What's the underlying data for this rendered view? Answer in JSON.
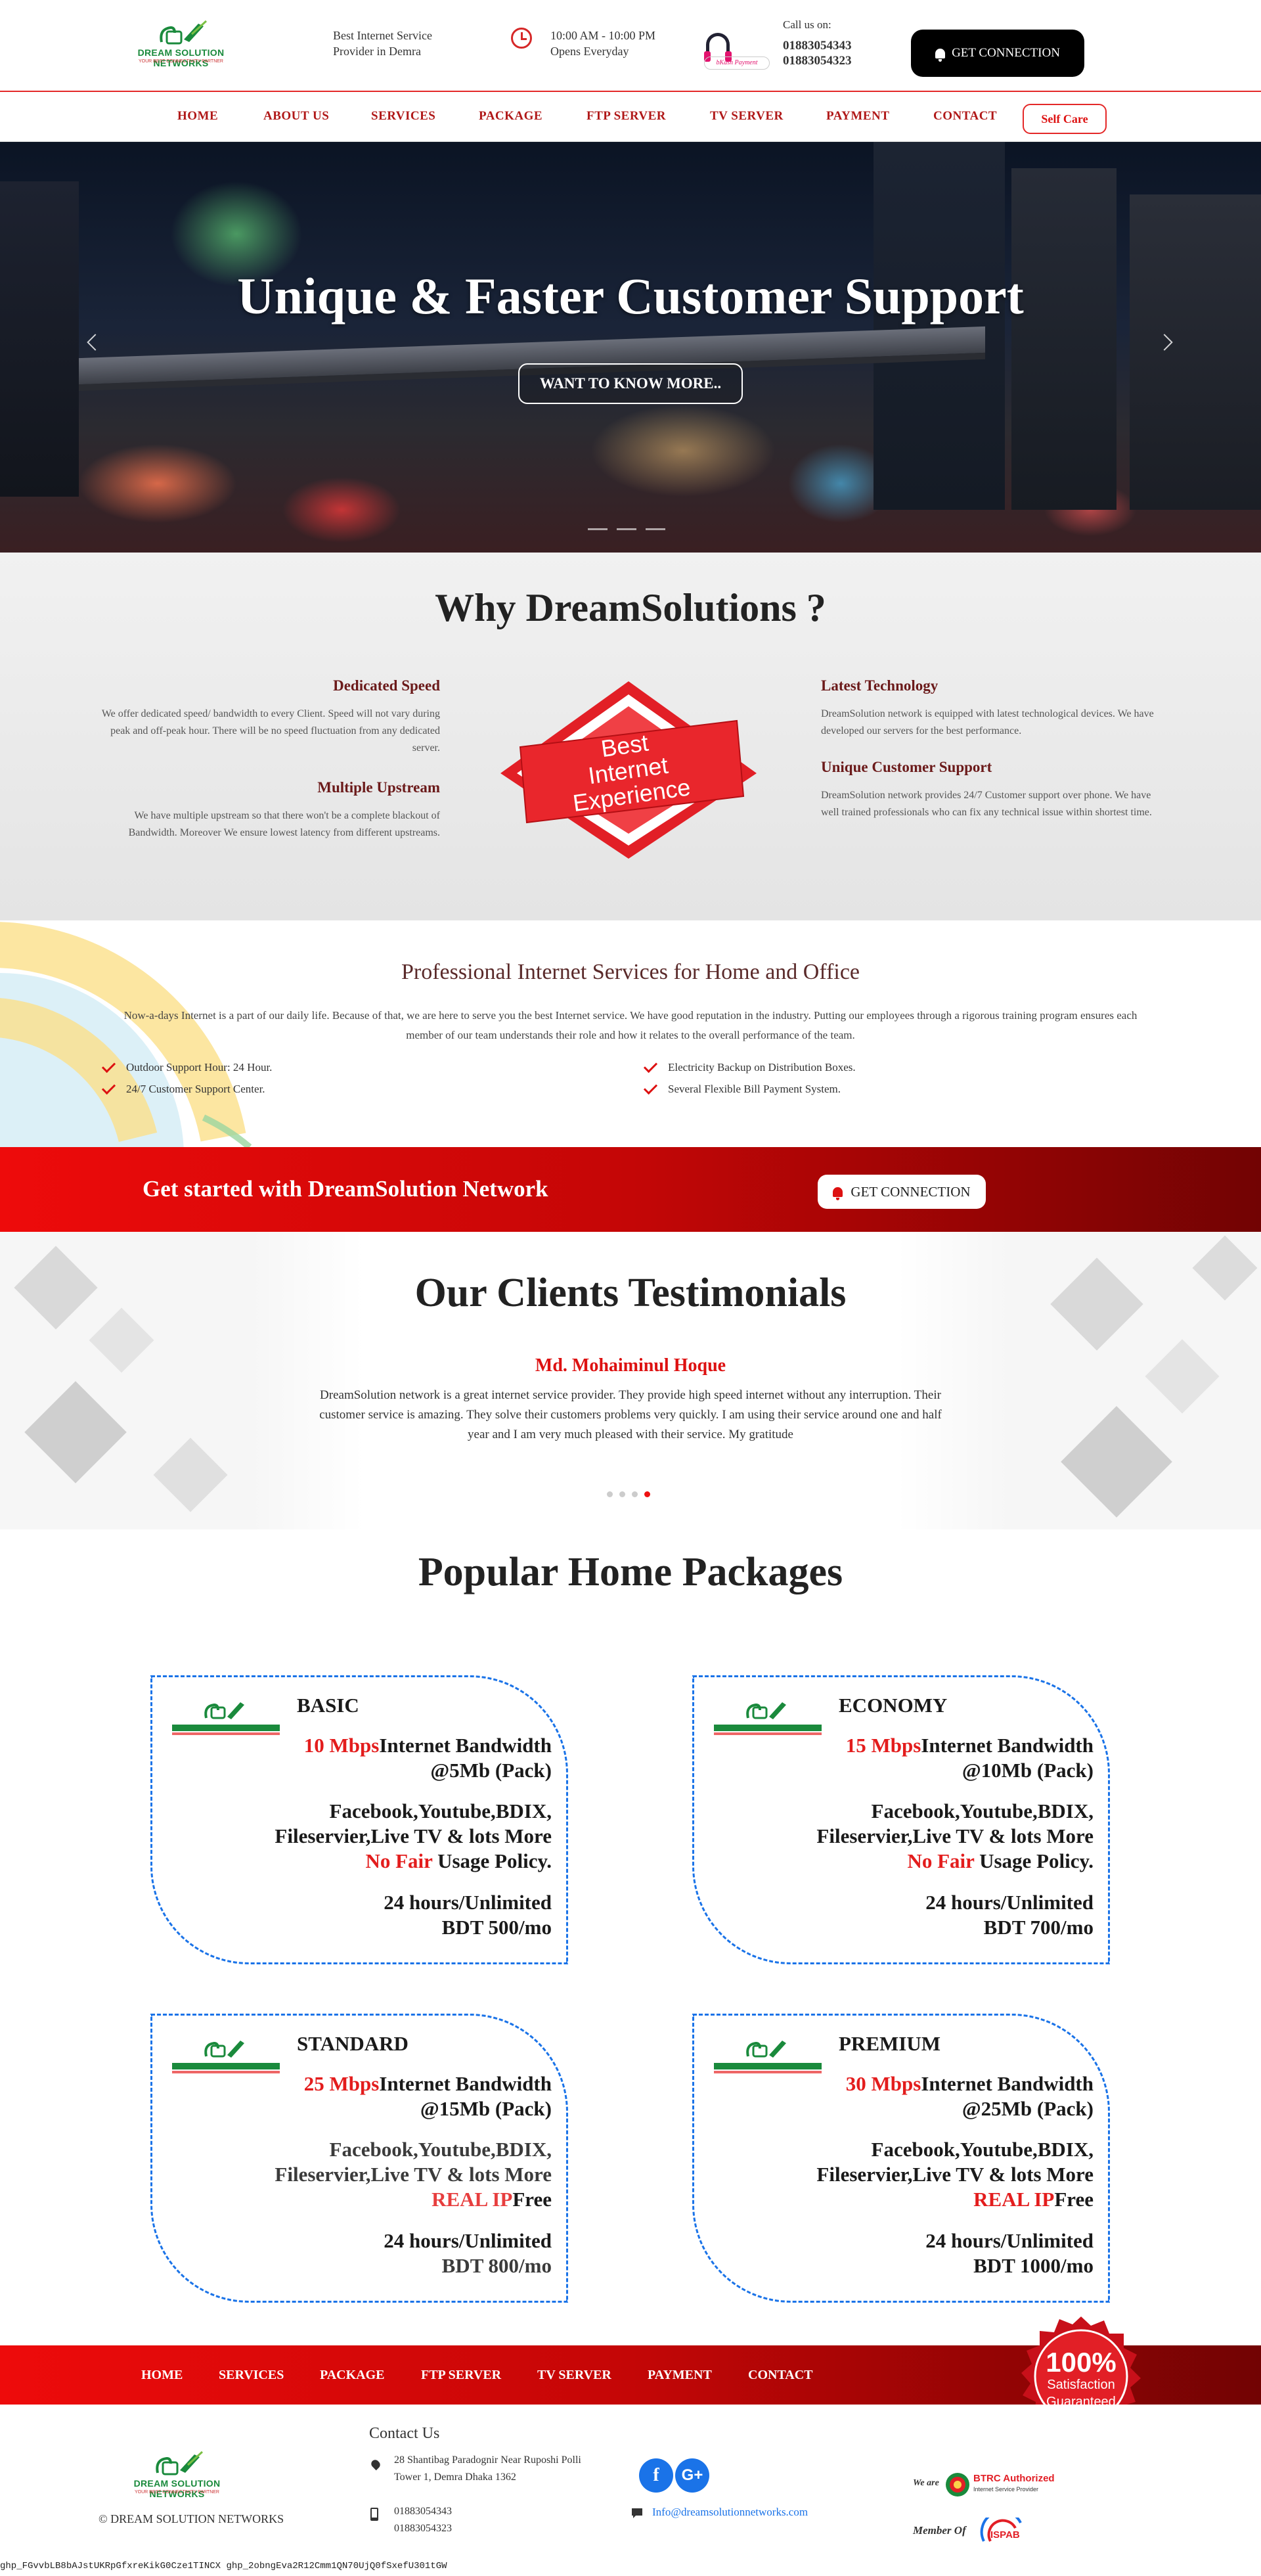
{
  "header": {
    "logo_brand": "DREAM SOLUTION NETWORKS",
    "logo_tagline": "YOUR BEST CONNECTIVITY PARTNER",
    "tagline_line1": "Best Internet Service",
    "tagline_line2": "Provider in Demra",
    "hours_line1": "10:00 AM - 10:00 PM",
    "hours_line2": "Opens Everyday",
    "bkash_label": "bKash Payment",
    "call_label": "Call us on:",
    "phone1": "01883054343",
    "phone2": "01883054323",
    "cta_label": "GET CONNECTION",
    "accent_color": "#e42828"
  },
  "nav": {
    "items": [
      "HOME",
      "ABOUT US",
      "SERVICES",
      "PACKAGE",
      "FTP SERVER",
      "TV SERVER",
      "PAYMENT",
      "CONTACT"
    ],
    "self_care": "Self Care"
  },
  "hero": {
    "title": "Unique & Faster Customer Support",
    "button": "WANT TO KNOW MORE.."
  },
  "why": {
    "title": "Why DreamSolutions ?",
    "badge_lines": [
      "Best",
      "Internet",
      "Experience"
    ],
    "features": [
      {
        "title": "Dedicated Speed",
        "text": "We offer dedicated speed/ bandwidth to every Client. Speed will not vary during peak and off-peak hour. There will be no speed fluctuation from any dedicated server."
      },
      {
        "title": "Multiple Upstream",
        "text": "We have multiple upstream so that there won't be a complete blackout of Bandwidth. Moreover We ensure lowest latency from different upstreams."
      },
      {
        "title": "Latest Technology",
        "text": "DreamSolution network is equipped with latest technological devices. We have developed our servers for the best performance."
      },
      {
        "title": "Unique Customer Support",
        "text": "DreamSolution network provides 24/7 Customer support over phone. We have well trained professionals who can fix any technical issue within shortest time."
      }
    ]
  },
  "professional": {
    "title": "Professional Internet Services for Home and Office",
    "text": "Now-a-days Internet is a part of our daily life. Because of that, we are here to serve you the best Internet service. We have good reputation in the industry. Putting our employees through a rigorous training program ensures each member of our team understands their role and how it relates to the overall performance of the team.",
    "checks": [
      "Outdoor Support Hour: 24 Hour.",
      "24/7 Customer Support Center.",
      "Electricity Backup on Distribution Boxes.",
      "Several Flexible Bill Payment System."
    ]
  },
  "cta": {
    "title": "Get started with DreamSolution Network",
    "button": "GET CONNECTION"
  },
  "testimonials": {
    "title": "Our Clients Testimonials",
    "name": "Md. Mohaiminul Hoque",
    "quote": "DreamSolution network is a great internet service provider. They provide high speed internet without any interruption. Their customer service is amazing. They solve their customers problems very quickly. I am using their service around one and half year and I am very much pleased with their service. My gratitude"
  },
  "packages": {
    "title": "Popular Home Packages",
    "items": [
      {
        "name": "BASIC",
        "speed": "10 Mbps",
        "bandwidth": "Internet Bandwidth",
        "pack": "@5Mb (Pack)",
        "perk1": "Facebook,Youtube,BDIX,",
        "perk2": "Fileservier,Live TV & lots More",
        "perk3_red": "No Fair",
        "perk3_rest": " Usage Policy.",
        "hours": "24 hours/Unlimited",
        "price": "BDT 500/mo"
      },
      {
        "name": "ECONOMY",
        "speed": "15 Mbps",
        "bandwidth": "Internet Bandwidth",
        "pack": "@10Mb (Pack)",
        "perk1": "Facebook,Youtube,BDIX,",
        "perk2": "Fileservier,Live TV & lots More",
        "perk3_red": "No Fair",
        "perk3_rest": " Usage Policy.",
        "hours": "24 hours/Unlimited",
        "price": "BDT 700/mo"
      },
      {
        "name": "STANDARD",
        "speed": "25 Mbps",
        "bandwidth": "Internet Bandwidth",
        "pack": "@15Mb (Pack)",
        "perk1": "Facebook,Youtube,BDIX,",
        "perk2": "Fileservier,Live TV & lots More",
        "perk3_red": "REAL IP",
        "perk3_rest": "Free",
        "hours": "24 hours/Unlimited",
        "price": "BDT 800/mo"
      },
      {
        "name": "PREMIUM",
        "speed": "30 Mbps",
        "bandwidth": "Internet Bandwidth",
        "pack": "@25Mb (Pack)",
        "perk1": "Facebook,Youtube,BDIX,",
        "perk2": "Fileservier,Live TV & lots More",
        "perk3_red": "REAL IP",
        "perk3_rest": "Free",
        "hours": "24 hours/Unlimited",
        "price": "BDT 1000/mo"
      }
    ]
  },
  "footer": {
    "nav": [
      "HOME",
      "SERVICES",
      "PACKAGE",
      "FTP SERVER",
      "TV SERVER",
      "PAYMENT",
      "CONTACT"
    ],
    "guarantee": [
      "100%",
      "Satisfaction",
      "Guaranteed"
    ],
    "copyright": "© DREAM SOLUTION NETWORKS",
    "contact_title": "Contact Us",
    "address1": "28 Shantibag Paradognir Near Ruposhi Polli",
    "address2": "Tower 1, Demra Dhaka 1362",
    "phone1": "01883054343",
    "phone2": "01883054323",
    "email": "Info@dreamsolutionnetworks.com",
    "btrc_prefix": "We are",
    "btrc_name": "BTRC Authorized",
    "btrc_sub": "Internet Service Provider",
    "member_of": "Member Of",
    "ispab": "ISPAB",
    "bottom_string": "ghp_FGvvbLB8bAJstUKRpGfxreKikG0Cze1TINCX ghp_2obngEva2R12Cmm1QN70UjQ0fSxefU301tGW"
  }
}
